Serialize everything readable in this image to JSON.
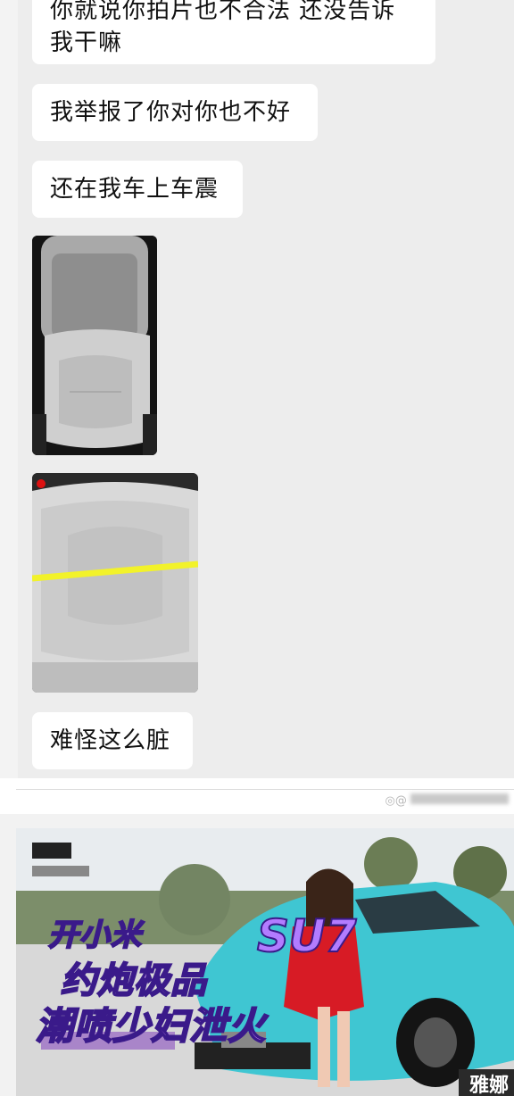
{
  "messages": [
    {
      "text_line1": "你就说你拍片也不合法 还没告诉",
      "text_line2": "我干嘛"
    },
    {
      "text": "我举报了你对你也不好"
    },
    {
      "text": "还在我车上车震"
    },
    {
      "text": "难怪这么脏"
    }
  ],
  "photos": [
    {
      "subject": "car seat"
    },
    {
      "subject": "car seat cushion"
    }
  ],
  "ad": {
    "line1": "开小米",
    "model": "SU7",
    "line2": "约炮极品",
    "line3": "潮喷少妇泄火",
    "corner_text": "雅娜"
  },
  "colors": {
    "background": "#ededed",
    "bubble": "#ffffff",
    "car": "#3fc6d2",
    "dress": "#d71b25",
    "ad_text": "#d78bff",
    "highlight_line": "#f2f22a"
  }
}
